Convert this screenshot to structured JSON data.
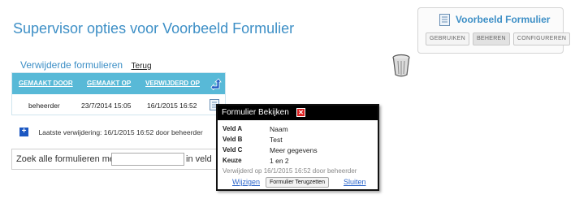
{
  "page": {
    "title": "Supervisor opties voor Voorbeeld Formulier"
  },
  "form_panel": {
    "title": "Voorbeeld Formulier",
    "buttons": [
      "GEBRUIKEN",
      "BEHEREN",
      "CONFIGUREREN"
    ],
    "active_button": "BEHEREN"
  },
  "deleted_section": {
    "title": "Verwijderde formulieren",
    "back_link": "Terug"
  },
  "table": {
    "headers": [
      "GEMAAKT DOOR",
      "GEMAAKT OP",
      "VERWIJDERD OP"
    ],
    "rows": [
      {
        "made_by": "beheerder",
        "made_on": "23/7/2014 15:05",
        "deleted_on": "16/1/2015 16:52"
      }
    ]
  },
  "last_deletion": "Laatste verwijdering: 16/1/2015 16:52 door beheerder",
  "search": {
    "label": "Zoek alle formulieren met",
    "value": "",
    "in_field": "in veld"
  },
  "popup": {
    "title": "Formulier Bekijken",
    "fields": [
      {
        "key": "Veld A",
        "value": "Naam"
      },
      {
        "key": "Veld B",
        "value": "Test"
      },
      {
        "key": "Veld C",
        "value": "Meer gegevens"
      },
      {
        "key": "Keuze",
        "value": "1 en 2"
      }
    ],
    "deleted_info": "Verwijderd op 16/1/2015 16:52 door beheerder",
    "edit_link": "Wijzigen",
    "restore_button": "Formulier Terugzetten",
    "close_link": "Sluiten"
  },
  "colors": {
    "accent": "#3d8fc6",
    "table_header": "#58b9d7",
    "popup_header": "#000000",
    "close_red": "#d22222"
  }
}
